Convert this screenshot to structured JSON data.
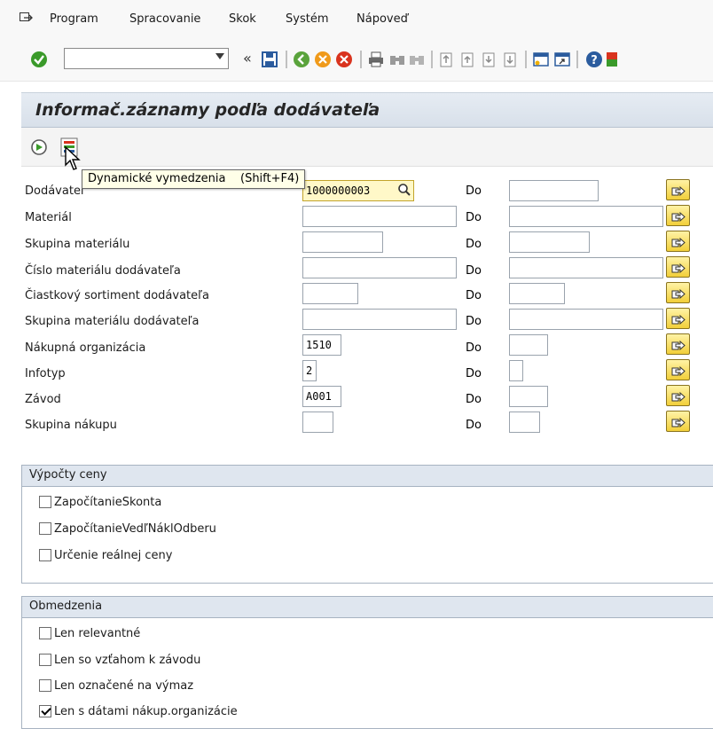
{
  "menu": {
    "items": [
      "Program",
      "Spracovanie",
      "Skok",
      "Systém",
      "Nápoveď"
    ]
  },
  "toolbar": {
    "command_value": "",
    "back_glyph": "«"
  },
  "screen": {
    "title": "Informač.záznamy podľa dodávateľa"
  },
  "tooltip": {
    "text": "Dynamické vymedzenia    (Shift+F4)"
  },
  "form": {
    "do_label": "Do",
    "rows": [
      {
        "label": "Dodávateľ",
        "from": "1000000003",
        "to": ""
      },
      {
        "label": "Materiál",
        "from": "",
        "to": ""
      },
      {
        "label": "Skupina materiálu",
        "from": "",
        "to": ""
      },
      {
        "label": "Číslo materiálu dodávateľa",
        "from": "",
        "to": ""
      },
      {
        "label": "Čiastkový sortiment dodávateľa",
        "from": "",
        "to": ""
      },
      {
        "label": "Skupina materiálu dodávateľa",
        "from": "",
        "to": ""
      },
      {
        "label": "Nákupná organizácia",
        "from": "1510",
        "to": ""
      },
      {
        "label": "Infotyp",
        "from": "2",
        "to": ""
      },
      {
        "label": "Závod",
        "from": "A001",
        "to": ""
      },
      {
        "label": "Skupina nákupu",
        "from": "",
        "to": ""
      }
    ]
  },
  "price_calc": {
    "title": "Výpočty ceny",
    "options": [
      {
        "label": "ZapočítanieSkonta",
        "checked": false
      },
      {
        "label": "ZapočítanieVedľNáklOdberu",
        "checked": false
      },
      {
        "label": "Určenie reálnej ceny",
        "checked": false
      }
    ]
  },
  "restrictions": {
    "title": "Obmedzenia",
    "options": [
      {
        "label": "Len relevantné",
        "checked": false
      },
      {
        "label": "Len so vzťahom k závodu",
        "checked": false
      },
      {
        "label": "Len označené na výmaz",
        "checked": false
      },
      {
        "label": "Len s dátami nákup.organizácie",
        "checked": true
      }
    ]
  },
  "colors": {
    "accent_green": "#3a9a2a",
    "title_band": "#dfe6ef",
    "highlight_field": "#fff8c8"
  }
}
